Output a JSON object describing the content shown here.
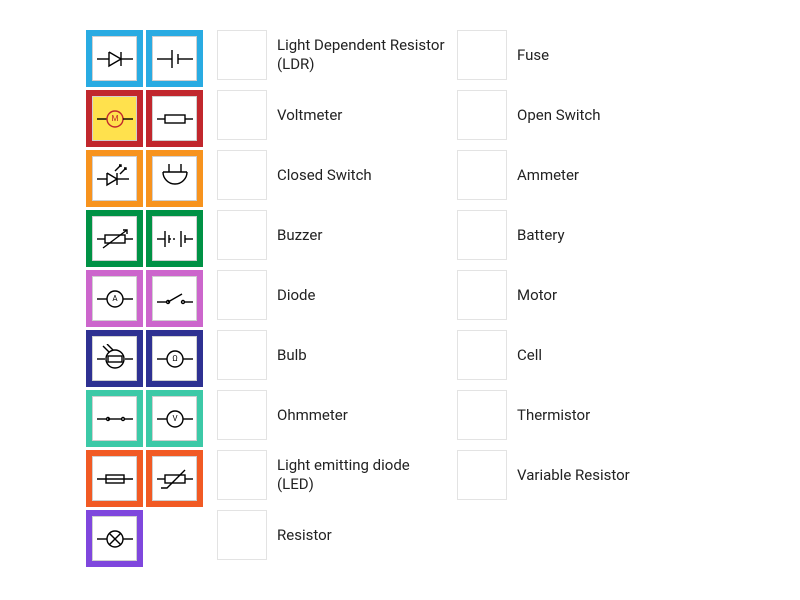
{
  "tokens": [
    {
      "id": "diode",
      "name": "diode-token",
      "color": "c-lightblue"
    },
    {
      "id": "cell",
      "name": "cell-token",
      "color": "c-lightblue"
    },
    {
      "id": "motor",
      "name": "motor-token",
      "color": "c-red",
      "extra_class": "yellow-bg"
    },
    {
      "id": "resistor",
      "name": "resistor-token",
      "color": "c-red"
    },
    {
      "id": "led",
      "name": "led-token",
      "color": "c-orange"
    },
    {
      "id": "buzzer",
      "name": "buzzer-token",
      "color": "c-orange"
    },
    {
      "id": "varres",
      "name": "variable-resistor-token",
      "color": "c-green"
    },
    {
      "id": "battery",
      "name": "battery-token",
      "color": "c-green"
    },
    {
      "id": "ammeter",
      "name": "ammeter-token",
      "color": "c-magenta"
    },
    {
      "id": "openswitch",
      "name": "open-switch-token",
      "color": "c-magenta"
    },
    {
      "id": "ldr",
      "name": "ldr-token",
      "color": "c-blue"
    },
    {
      "id": "ohmmeter",
      "name": "ohmmeter-token",
      "color": "c-blue"
    },
    {
      "id": "closedswitch",
      "name": "closed-switch-token",
      "color": "c-mint"
    },
    {
      "id": "voltmeter",
      "name": "voltmeter-token",
      "color": "c-mint"
    },
    {
      "id": "fuse",
      "name": "fuse-token",
      "color": "c-orangered"
    },
    {
      "id": "thermistor",
      "name": "thermistor-token",
      "color": "c-orangered"
    },
    {
      "id": "bulb",
      "name": "bulb-token",
      "color": "c-purple"
    }
  ],
  "labels_left": [
    "Light Dependent Resistor (LDR)",
    "Voltmeter",
    "Closed Switch",
    "Buzzer",
    "Diode",
    "Bulb",
    "Ohmmeter",
    "Light emitting diode (LED)",
    "Resistor"
  ],
  "labels_right": [
    "Fuse",
    "Open Switch",
    "Ammeter",
    "Battery",
    "Motor",
    "Cell",
    "Thermistor",
    "Variable Resistor"
  ]
}
